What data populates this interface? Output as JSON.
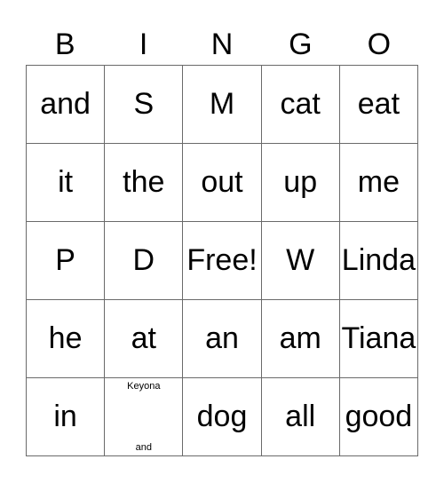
{
  "header": [
    "B",
    "I",
    "N",
    "G",
    "O"
  ],
  "cells": [
    [
      "and",
      "S",
      "M",
      "cat",
      "eat"
    ],
    [
      "it",
      "the",
      "out",
      "up",
      "me"
    ],
    [
      "P",
      "D",
      "Free!",
      "W",
      "Linda"
    ],
    [
      "he",
      "at",
      "an",
      "am",
      "Tiana"
    ],
    [
      "in",
      {
        "top": "Keyona",
        "bottom": "and"
      },
      "dog",
      "all",
      "good"
    ]
  ]
}
